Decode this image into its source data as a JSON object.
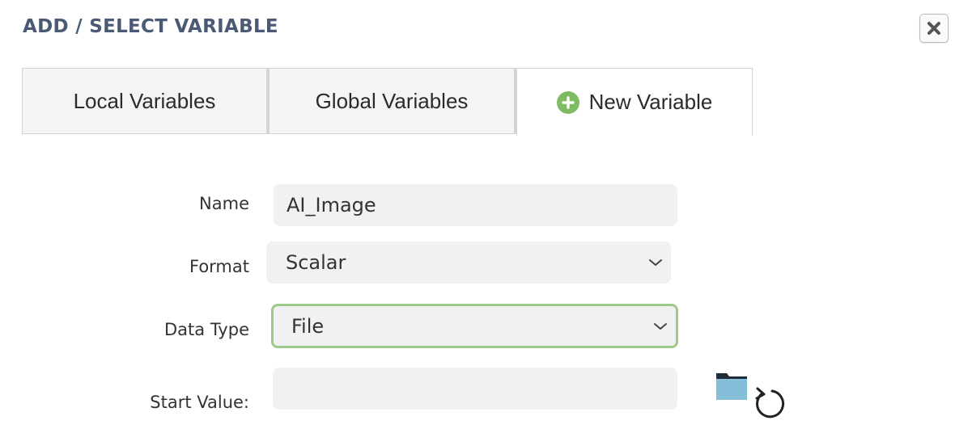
{
  "dialog": {
    "title": "ADD / SELECT VARIABLE",
    "close_icon": "close-icon"
  },
  "tabs": [
    {
      "label": "Local Variables"
    },
    {
      "label": "Global Variables"
    },
    {
      "label": "New Variable",
      "icon": "plus-circle-icon",
      "active": true
    }
  ],
  "form": {
    "name": {
      "label": "Name",
      "value": "AI_Image"
    },
    "format": {
      "label": "Format",
      "value": "Scalar",
      "icon": "chevron-down-icon"
    },
    "data_type": {
      "label": "Data Type",
      "value": "File",
      "icon": "chevron-down-icon"
    },
    "start_value": {
      "label": "Start Value:",
      "value": "",
      "icons": [
        "folder-icon",
        "refresh-icon"
      ]
    }
  },
  "colors": {
    "title": "#4a5a75",
    "accent_green": "#7fbb63",
    "focus_border": "#9dc98a",
    "folder": "#84bed8",
    "field_bg": "#f1f1f3"
  }
}
